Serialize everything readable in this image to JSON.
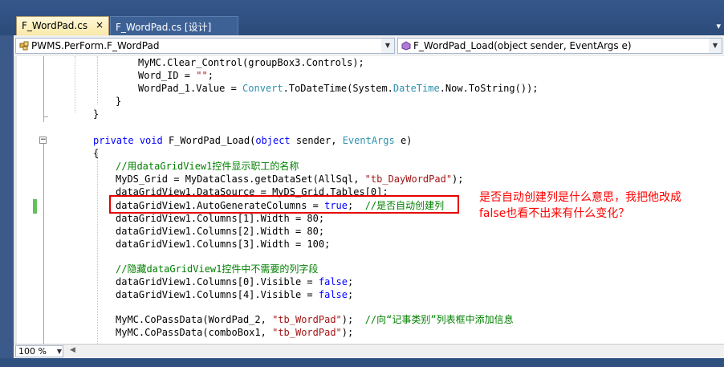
{
  "tabs": [
    {
      "label": "F_WordPad.cs",
      "close": "×"
    },
    {
      "label": "F_WordPad.cs [设计]"
    }
  ],
  "nav": {
    "class_dropdown": "PWMS.PerForm.F_WordPad",
    "member_dropdown": "F_WordPad_Load(object sender, EventArgs e)",
    "dropdown_arrow": "▼"
  },
  "code": {
    "l1": "MyMC.Clear_Control(groupBox3.Controls);",
    "l2_a": "Word_ID = ",
    "l2_b": "\"\"",
    "l2_c": ";",
    "l3_a": "WordPad_1.Value = ",
    "l3_b": "Convert",
    "l3_c": ".ToDateTime(System.",
    "l3_d": "DateTime",
    "l3_e": ".Now.ToString());",
    "l4": "}",
    "l5": "}",
    "l7_a": "private",
    "l7_b": " ",
    "l7_c": "void",
    "l7_d": " F_WordPad_Load(",
    "l7_e": "object",
    "l7_f": " sender, ",
    "l7_g": "EventArgs",
    "l7_h": " e)",
    "l8": "{",
    "l9": "//用dataGridView1控件显示职工的名称",
    "l10_a": "MyDS_Grid = MyDataClass.getDataSet(AllSql, ",
    "l10_b": "\"tb_DayWordPad\"",
    "l10_c": ");",
    "l11": "dataGridView1.DataSource = MyDS_Grid.Tables[0];",
    "l12_a": "dataGridView1.AutoGenerateColumns = ",
    "l12_b": "true",
    "l12_c": ";  ",
    "l12_d": "//是否自动创建列",
    "l13": "dataGridView1.Columns[1].Width = 80;",
    "l14": "dataGridView1.Columns[2].Width = 80;",
    "l15": "dataGridView1.Columns[3].Width = 100;",
    "l17": "//隐藏dataGridView1控件中不需要的列字段",
    "l18_a": "dataGridView1.Columns[0].Visible = ",
    "l18_b": "false",
    "l18_c": ";",
    "l19_a": "dataGridView1.Columns[4].Visible = ",
    "l19_b": "false",
    "l19_c": ";",
    "l21_a": "MyMC.CoPassData(WordPad_2, ",
    "l21_b": "\"tb_WordPad\"",
    "l21_c": ");  ",
    "l21_d": "//向“记事类别”列表框中添加信息",
    "l22_a": "MyMC.CoPassData(comboBox1, ",
    "l22_b": "\"tb_WordPad\"",
    "l22_c": ");"
  },
  "annotation": {
    "line1": "是否自动创建列是什么意思，我把他改成",
    "line2": "false也看不出来有什么变化？"
  },
  "status": {
    "zoom": "100 %",
    "zoom_arrow": "▼",
    "scroll_left": "◀"
  },
  "colors": {
    "keyword": "#0000ff",
    "type": "#2b91af",
    "string": "#a31515",
    "comment": "#008000",
    "annotation": "#ff0000"
  }
}
